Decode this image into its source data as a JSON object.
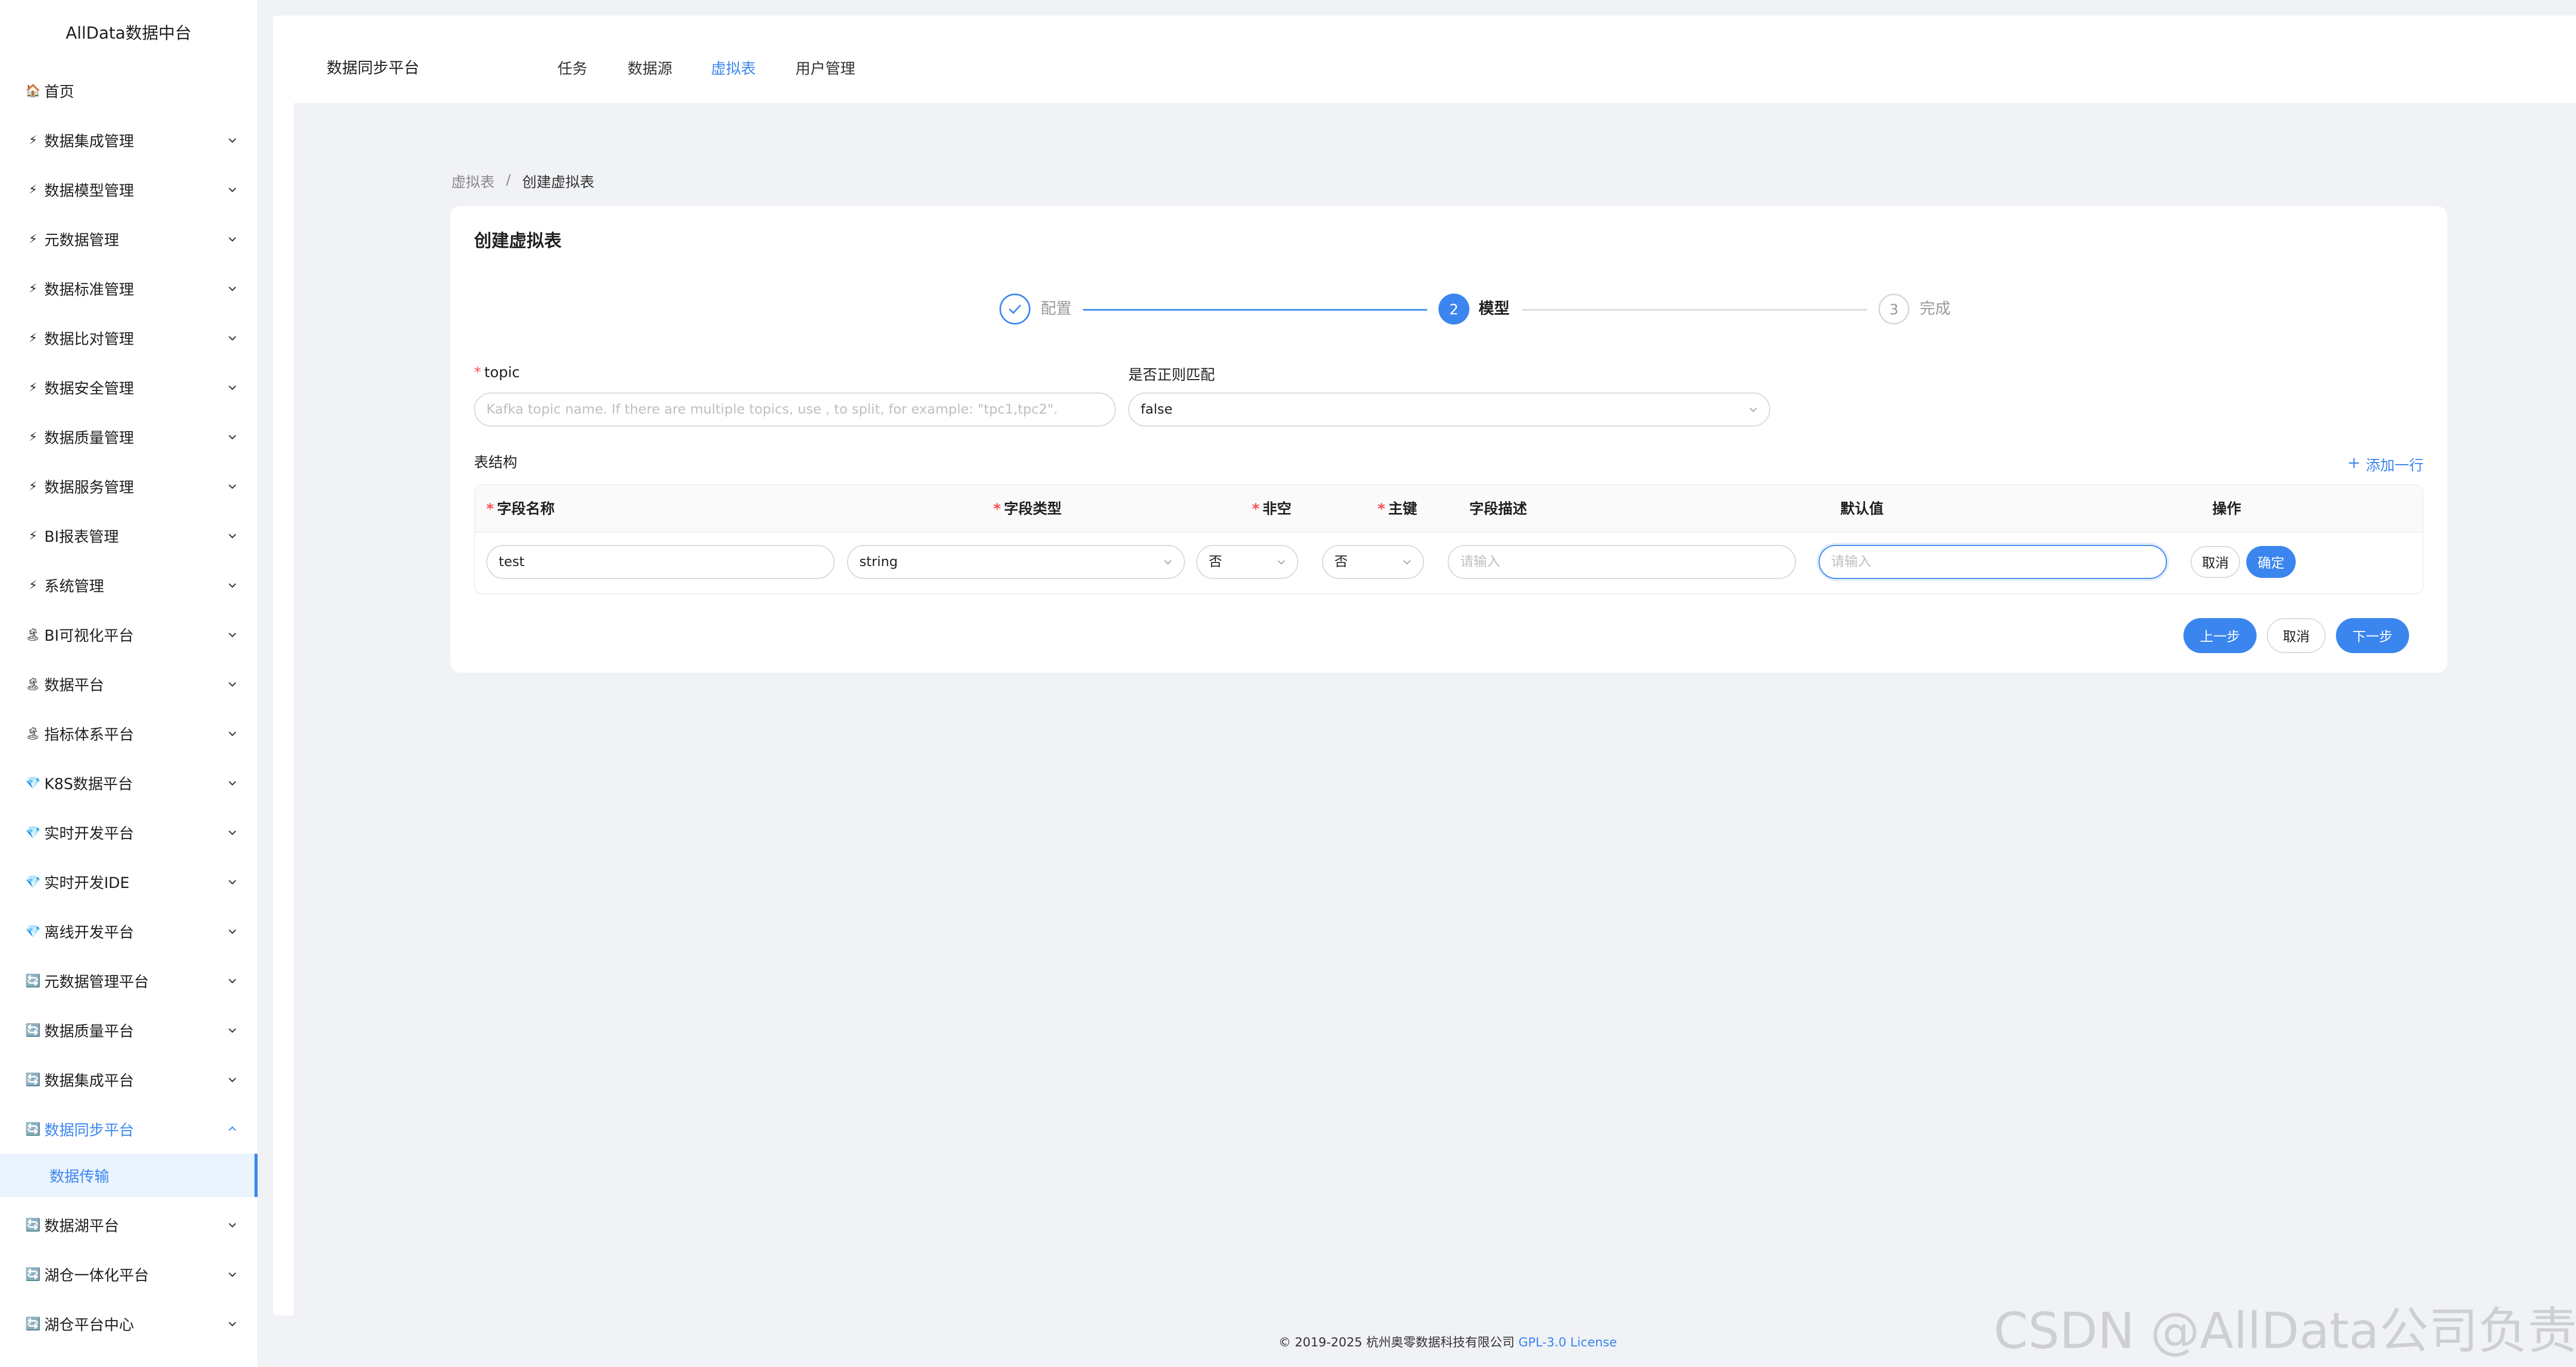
{
  "app": {
    "title": "AllData数据中台"
  },
  "sidebar": {
    "items": [
      {
        "icon": "🏠",
        "label": "首页",
        "chevron": false
      },
      {
        "icon": "⚡",
        "label": "数据集成管理",
        "chevron": true
      },
      {
        "icon": "⚡",
        "label": "数据模型管理",
        "chevron": true
      },
      {
        "icon": "⚡",
        "label": "元数据管理",
        "chevron": true
      },
      {
        "icon": "⚡",
        "label": "数据标准管理",
        "chevron": true
      },
      {
        "icon": "⚡",
        "label": "数据比对管理",
        "chevron": true
      },
      {
        "icon": "⚡",
        "label": "数据安全管理",
        "chevron": true
      },
      {
        "icon": "⚡",
        "label": "数据质量管理",
        "chevron": true
      },
      {
        "icon": "⚡",
        "label": "数据服务管理",
        "chevron": true
      },
      {
        "icon": "⚡",
        "label": "BI报表管理",
        "chevron": true
      },
      {
        "icon": "⚡",
        "label": "系统管理",
        "chevron": true
      },
      {
        "icon": "🏝",
        "label": "BI可视化平台",
        "chevron": true
      },
      {
        "icon": "🏝",
        "label": "数据平台",
        "chevron": true
      },
      {
        "icon": "🏝",
        "label": "指标体系平台",
        "chevron": true
      },
      {
        "icon": "💎",
        "label": "K8S数据平台",
        "chevron": true
      },
      {
        "icon": "💎",
        "label": "实时开发平台",
        "chevron": true
      },
      {
        "icon": "💎",
        "label": "实时开发IDE",
        "chevron": true
      },
      {
        "icon": "💎",
        "label": "离线开发平台",
        "chevron": true
      },
      {
        "icon": "🔄",
        "label": "元数据管理平台",
        "chevron": true
      },
      {
        "icon": "🔄",
        "label": "数据质量平台",
        "chevron": true
      },
      {
        "icon": "🔄",
        "label": "数据集成平台",
        "chevron": true
      },
      {
        "icon": "🔄",
        "label": "数据同步平台",
        "chevron": true,
        "open": true
      },
      {
        "icon": "🔄",
        "label": "数据湖平台",
        "chevron": true
      },
      {
        "icon": "🔄",
        "label": "湖仓一体化平台",
        "chevron": true
      },
      {
        "icon": "🔄",
        "label": "湖仓平台中心",
        "chevron": true
      }
    ],
    "subitem": "数据传输",
    "active_color": "#3b86ee"
  },
  "topnav": {
    "system": "数据同步平台",
    "tabs": [
      "任务",
      "数据源",
      "虚拟表",
      "用户管理"
    ],
    "active_tab": "虚拟表"
  },
  "breadcrumb": {
    "parent": "虚拟表",
    "sep": "/",
    "current": "创建虚拟表"
  },
  "card": {
    "title": "创建虚拟表",
    "steps": [
      {
        "index": "1",
        "label": "配置",
        "status": "finished"
      },
      {
        "index": "2",
        "label": "模型",
        "status": "current"
      },
      {
        "index": "3",
        "label": "完成",
        "status": "waiting"
      }
    ],
    "topic_label": "topic",
    "topic_placeholder": "Kafka topic name. If there are multiple topics, use , to split, for example: \"tpc1,tpc2\".",
    "regex_label": "是否正则匹配",
    "regex_value": "false",
    "section_title": "表结构",
    "add_row": "添加一行",
    "columns": [
      "字段名称",
      "字段类型",
      "非空",
      "主键",
      "字段描述",
      "默认值",
      "操作"
    ],
    "row": {
      "name": "test",
      "type": "string",
      "not_null": "否",
      "primary": "否",
      "desc_placeholder": "请输入",
      "default_placeholder": "请输入",
      "cancel": "取消",
      "confirm": "确定"
    },
    "buttons": {
      "prev": "上一步",
      "cancel": "取消",
      "next": "下一步"
    }
  },
  "footer": {
    "text": "© 2019-2025 杭州奥零数据科技有限公司",
    "license": "GPL-3.0 License"
  },
  "watermark": "CSDN @AllData公司负责人"
}
